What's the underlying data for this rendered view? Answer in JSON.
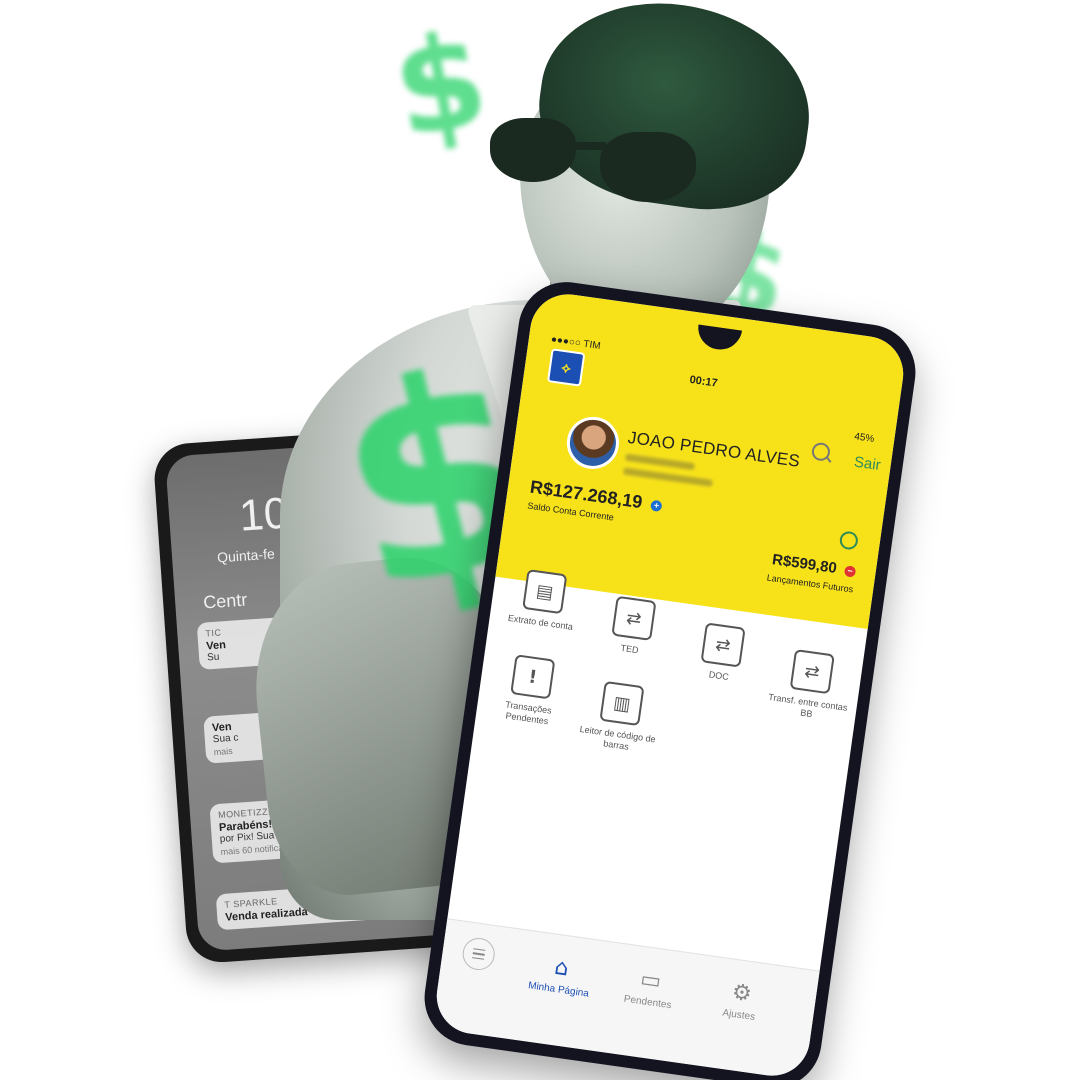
{
  "back_phone": {
    "time": "10",
    "date": "Quinta-fe",
    "notifications_header": "Centr",
    "notifications": [
      {
        "app": "TIC",
        "title": "Ven",
        "sub": "Su",
        "more": ""
      },
      {
        "app": "",
        "title": "Ven",
        "sub": "Sua c",
        "more": "mais"
      },
      {
        "app": "MONETIZZE",
        "title": "Parabéns! Você acaba",
        "sub": "por Pix! Sua Comissão:",
        "more": "mais 60 notificações"
      },
      {
        "app": "T SPARKLE",
        "title": "Venda realizada",
        "sub": "",
        "more": ""
      }
    ]
  },
  "front_phone": {
    "status": {
      "carrier": "●●●○○ TIM",
      "time": "00:17",
      "battery": "45%"
    },
    "brand_logo": "bb-logo",
    "user": {
      "name": "JOAO PEDRO ALVES"
    },
    "header_actions": {
      "exit_label": "Sair"
    },
    "account": {
      "balance": "R$127.268,19",
      "balance_label": "Saldo Conta Corrente",
      "future_amount": "R$599,80",
      "future_label": "Lançamentos Futuros"
    },
    "shortcuts": [
      {
        "label": "Extrato de conta",
        "icon": "statement-icon",
        "glyph": "▤"
      },
      {
        "label": "TED",
        "icon": "transfer-icon",
        "glyph": "⇄"
      },
      {
        "label": "DOC",
        "icon": "transfer-icon",
        "glyph": "⇄"
      },
      {
        "label": "Transf. entre contas BB",
        "icon": "transfer-icon",
        "glyph": "⇄"
      },
      {
        "label": "Transações Pendentes",
        "icon": "alert-icon",
        "glyph": "!"
      },
      {
        "label": "Leitor de código de barras",
        "icon": "barcode-icon",
        "glyph": "▥"
      }
    ],
    "tabs": [
      {
        "label": "Minha Página",
        "icon": "home-icon",
        "glyph": "⌂"
      },
      {
        "label": "Pendentes",
        "icon": "folder-icon",
        "glyph": "▭"
      },
      {
        "label": "Ajustes",
        "icon": "gear-icon",
        "glyph": "⚙"
      }
    ]
  },
  "colors": {
    "brand_yellow": "#f7e21a",
    "brand_blue": "#1c4fb3",
    "dollar_green": "#2ad36a"
  }
}
